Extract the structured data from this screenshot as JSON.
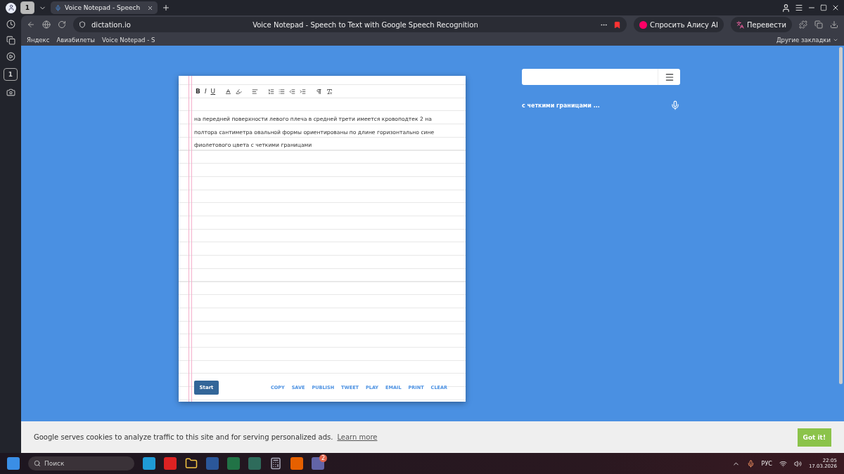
{
  "browser": {
    "tab_counter": "1",
    "tabs": [
      {
        "title": "Voice Notepad - Speech",
        "selected": true
      }
    ],
    "address": "dictation.io",
    "page_title": "Voice Notepad - Speech to Text with Google Speech Recognition",
    "alice_button": "Спросить Алису AI",
    "translate_button": "Перевести",
    "bookmarks": [
      "Яндекс",
      "Авиабилеты",
      "Voice Notepad - S"
    ],
    "other_bookmarks": "Другие закладки"
  },
  "sidebar": {
    "tab_counter": "1"
  },
  "editor": {
    "toolbar_letters": [
      "B",
      "I",
      "U"
    ],
    "lines": [
      "на передней поверхности левого плеча в средней трети имеется кровоподтек 2 на",
      "полтора сантиметра овальной формы ориентированы по длине горизонтально сине",
      "фиолетового цвета с четкими границами"
    ],
    "start_button": "Start",
    "actions": [
      "COPY",
      "SAVE",
      "PUBLISH",
      "TWEET",
      "PLAY",
      "EMAIL",
      "PRINT",
      "CLEAR"
    ]
  },
  "transcript": {
    "text": "с четкими границами ..."
  },
  "cookie_bar": {
    "text": "Google serves cookies to analyze traffic to this site and for serving personalized ads.",
    "link": "Learn more",
    "button": "Got it!"
  },
  "taskbar": {
    "search_placeholder": "Поиск",
    "notification_badge": "2",
    "language": "РУС",
    "time": "22:05",
    "date": "17.03.2026"
  }
}
